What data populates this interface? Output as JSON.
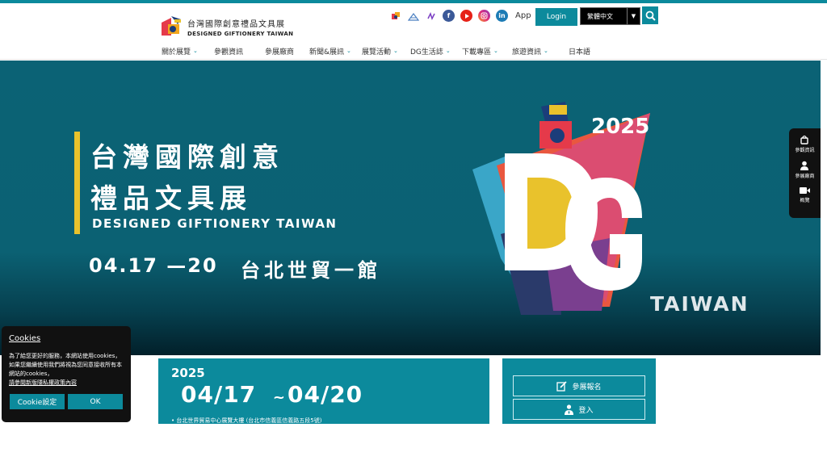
{
  "header": {
    "logo_zh": "台灣國際創意禮品文具展",
    "logo_en": "DESIGNED GIFTIONERY TAIWAN",
    "social_icons": [
      "dg-icon",
      "mountain-icon",
      "line-icon",
      "facebook-icon",
      "youtube-icon",
      "instagram-icon",
      "linkedin-icon"
    ],
    "app_label": "App",
    "login_label": "Login",
    "language_selected": "繁體中文"
  },
  "nav": {
    "items": [
      {
        "label": "關於展覽",
        "dropdown": true
      },
      {
        "label": "參觀資訊",
        "dropdown": false
      },
      {
        "label": "參展廠商",
        "dropdown": false
      },
      {
        "label": "新聞&展訊",
        "dropdown": true
      },
      {
        "label": "展覽活動",
        "dropdown": true
      },
      {
        "label": "DG生活誌",
        "dropdown": true
      },
      {
        "label": "下載專區",
        "dropdown": true
      },
      {
        "label": "旅遊資訊",
        "dropdown": true
      },
      {
        "label": "日本語",
        "dropdown": false
      }
    ]
  },
  "hero": {
    "title_line1": "台灣國際創意",
    "title_line2": "禮品文具展",
    "subtitle": "DESIGNED GIFTIONERY TAIWAN",
    "date": "04.17 —20",
    "venue": "台北世貿一館",
    "art_year": "2025",
    "art_taiwan": "TAIWAN"
  },
  "side_float": {
    "items": [
      {
        "icon": "bag-icon",
        "label": "參觀資訊"
      },
      {
        "icon": "person-icon",
        "label": "參展廠商"
      },
      {
        "icon": "video-icon",
        "label": "概覽"
      }
    ]
  },
  "date_box": {
    "year": "2025",
    "range_start": "04/17",
    "range_sep": "~",
    "range_end": "04/20",
    "venue": "• 台北世界貿易中心展覽大樓 (台北市信義區信義路五段5號)"
  },
  "register_box": {
    "register_label": "參展報名",
    "login_label": "登入"
  },
  "cookie": {
    "title": "Cookies",
    "text": "為了給您更好的服務，本網站使用cookies，如果您繼續使用我們將視為您同意接收所有本網站的cookies，",
    "link": "請參閱新版隱私權政策內容",
    "settings_label": "Cookie設定",
    "ok_label": "OK"
  },
  "colors": {
    "accent": "#0c8a9c",
    "hero_bg": "#0b6275",
    "hero_bar": "#e9c22c"
  }
}
